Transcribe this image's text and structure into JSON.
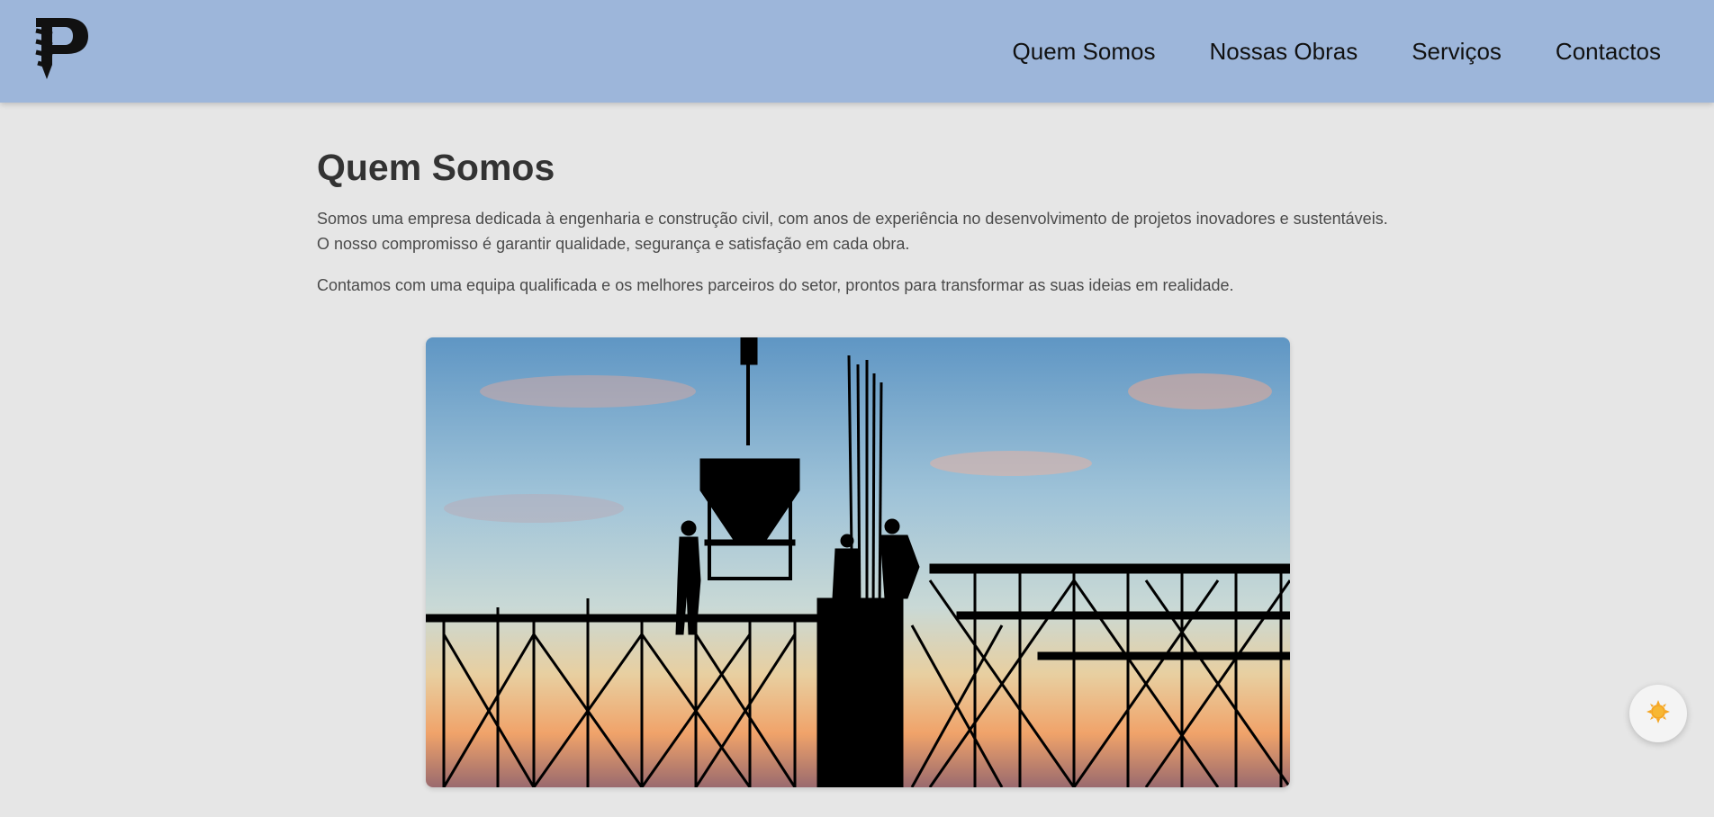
{
  "header": {
    "logo_alt": "P",
    "nav": [
      {
        "label": "Quem Somos"
      },
      {
        "label": "Nossas Obras"
      },
      {
        "label": "Serviços"
      },
      {
        "label": "Contactos"
      }
    ]
  },
  "main": {
    "title": "Quem Somos",
    "paragraphs": [
      "Somos uma empresa dedicada à engenharia e construção civil, com anos de experiência no desenvolvimento de projetos inovadores e sustentáveis. O nosso compromisso é garantir qualidade, segurança e satisfação em cada obra.",
      "Contamos com uma equipa qualificada e os melhores parceiros do setor, prontos para transformar as suas ideias em realidade."
    ],
    "hero_image": {
      "description_icon": "construction-silhouette-image"
    }
  },
  "theme_toggle": {
    "icon": "sun-icon"
  },
  "colors": {
    "header_bg": "#9db6da",
    "page_bg": "#e6e6e6",
    "heading": "#333333",
    "text": "#4a4a4a",
    "sun": "#f5a623"
  }
}
